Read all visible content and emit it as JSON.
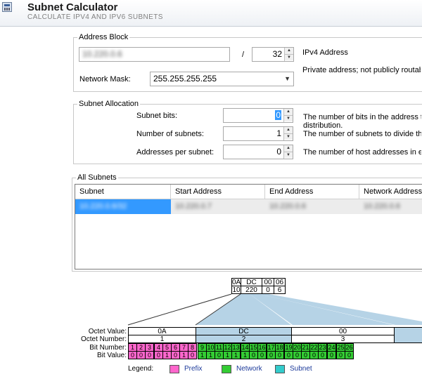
{
  "header": {
    "title": "Subnet Calculator",
    "subtitle": "CALCULATE IPV4 AND IPV6 SUBNETS",
    "icon": "calculator-icon"
  },
  "address_block": {
    "legend": "Address Block",
    "ip_value": "10.220.0.6",
    "slash": "/",
    "prefix_value": "32",
    "ip_type": "IPv4 Address",
    "private_note": "Private address; not publicly routable",
    "mask_label": "Network Mask:",
    "mask_value": "255.255.255.255"
  },
  "subnet_allocation": {
    "legend": "Subnet Allocation",
    "subnet_bits_label": "Subnet bits:",
    "subnet_bits_value": "0",
    "subnet_bits_desc": "The number of bits in the address that are used for subnet",
    "subnet_bits_desc2": "distribution.",
    "num_subnets_label": "Number of subnets:",
    "num_subnets_value": "1",
    "num_subnets_desc": "The number of subnets to divide the address block into.",
    "addr_per_subnet_label": "Addresses per subnet:",
    "addr_per_subnet_value": "0",
    "addr_per_subnet_desc": "The number of host addresses in each subnet."
  },
  "all_subnets": {
    "legend": "All Subnets",
    "columns": [
      "Subnet",
      "Start Address",
      "End Address",
      "Network Address"
    ],
    "rows": [
      [
        "10.220.0.6/32",
        "10.220.0.7",
        "10.220.0.6",
        "10.220.0.6"
      ]
    ]
  },
  "hex_box": {
    "hex": [
      "0A",
      "DC",
      "00",
      "06"
    ],
    "dec": [
      "10",
      "220",
      "0",
      "6"
    ]
  },
  "bit_grid": {
    "row_labels": [
      "Octet Value:",
      "Octet Number:",
      "Bit Number:",
      "Bit Value:"
    ],
    "octets": [
      {
        "value": "0A",
        "number": "1",
        "bits": [
          "0",
          "0",
          "0",
          "0",
          "1",
          "0",
          "1",
          "0"
        ]
      },
      {
        "value": "DC",
        "number": "2",
        "bits": [
          "1",
          "1",
          "0",
          "1",
          "1",
          "1",
          "0",
          "0"
        ]
      },
      {
        "value": "00",
        "number": "3",
        "bits": [
          "0",
          "0",
          "0",
          "0",
          "0",
          "0",
          "0",
          "0"
        ]
      }
    ],
    "bit_numbers": [
      "1",
      "2",
      "3",
      "4",
      "5",
      "6",
      "7",
      "8",
      "9",
      "10",
      "11",
      "12",
      "13",
      "14",
      "15",
      "16",
      "17",
      "18",
      "19",
      "20",
      "21",
      "22",
      "23",
      "24",
      "25",
      "26"
    ]
  },
  "legend": {
    "title": "Legend:",
    "items": [
      {
        "label": "Prefix",
        "color": "#ff66cc"
      },
      {
        "label": "Network",
        "color": "#33cc33"
      },
      {
        "label": "Subnet",
        "color": "#33cccc"
      }
    ]
  },
  "colors": {
    "prefix": "#ff66cc",
    "network": "#33cc33",
    "subnet": "#33cccc",
    "selection": "#3399ff",
    "funnel": "#b6d3e6"
  }
}
